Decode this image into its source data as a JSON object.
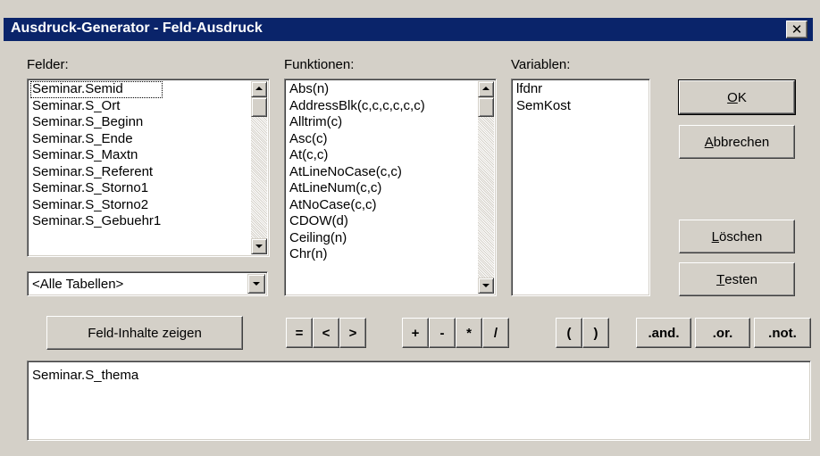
{
  "window": {
    "title": "Ausdruck-Generator - Feld-Ausdruck",
    "close_glyph": "✕"
  },
  "felder": {
    "label": "Felder:",
    "items": [
      "Seminar.Semid",
      "Seminar.S_Ort",
      "Seminar.S_Beginn",
      "Seminar.S_Ende",
      "Seminar.S_Maxtn",
      "Seminar.S_Referent",
      "Seminar.S_Storno1",
      "Seminar.S_Storno2",
      "Seminar.S_Gebuehr1"
    ],
    "focused_index": 0
  },
  "tabellen_combo": {
    "value": "<Alle Tabellen>"
  },
  "funktionen": {
    "label": "Funktionen:",
    "items": [
      "Abs(n)",
      "AddressBlk(c,c,c,c,c,c)",
      "Alltrim(c)",
      "Asc(c)",
      "At(c,c)",
      "AtLineNoCase(c,c)",
      "AtLineNum(c,c)",
      "AtNoCase(c,c)",
      "CDOW(d)",
      "Ceiling(n)",
      "Chr(n)"
    ]
  },
  "variablen": {
    "label": "Variablen:",
    "items": [
      "lfdnr",
      "SemKost"
    ]
  },
  "buttons": {
    "ok": {
      "mnemonic": "O",
      "rest": "K"
    },
    "abbrechen": {
      "mnemonic": "A",
      "rest": "bbrechen"
    },
    "loeschen": {
      "mnemonic": "L",
      "rest": "öschen"
    },
    "testen": {
      "mnemonic": "T",
      "rest": "esten"
    },
    "feld_inhalte": "Feld-Inhalte zeigen"
  },
  "operators": {
    "eq": "=",
    "lt": "<",
    "gt": ">",
    "plus": "+",
    "minus": "-",
    "times": "*",
    "divide": "/",
    "lparen": "(",
    "rparen": ")",
    "and": ".and.",
    "or": ".or.",
    "not": ".not."
  },
  "expression": {
    "value": "Seminar.S_thema"
  },
  "colors": {
    "titlebar": "#0a246a",
    "dialog_face": "#d4d0c8"
  }
}
